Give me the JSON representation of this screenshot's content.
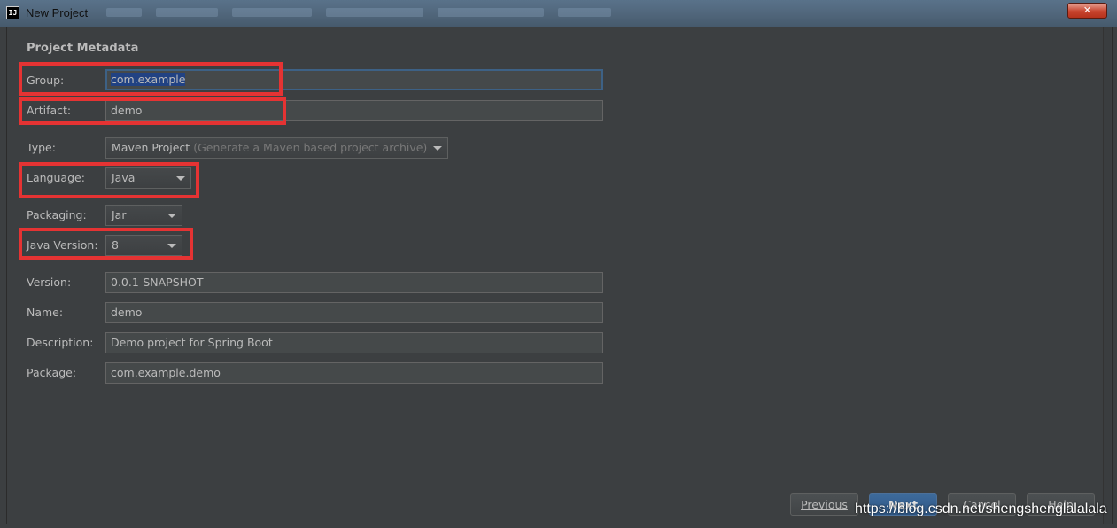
{
  "window": {
    "title": "New Project",
    "close_label": "✕"
  },
  "section_title": "Project Metadata",
  "form": {
    "group": {
      "label": "Group:",
      "value": "com.example"
    },
    "artifact": {
      "label": "Artifact:",
      "value": "demo"
    },
    "type": {
      "label": "Type:",
      "value": "Maven Project",
      "hint": "(Generate a Maven based project archive)"
    },
    "language": {
      "label": "Language:",
      "value": "Java"
    },
    "packaging": {
      "label": "Packaging:",
      "value": "Jar"
    },
    "java_version": {
      "label": "Java Version:",
      "value": "8"
    },
    "version": {
      "label": "Version:",
      "value": "0.0.1-SNAPSHOT"
    },
    "name": {
      "label": "Name:",
      "value": "demo"
    },
    "description": {
      "label": "Description:",
      "value": "Demo project for Spring Boot"
    },
    "package": {
      "label": "Package:",
      "value": "com.example.demo"
    }
  },
  "buttons": {
    "previous": "Previous",
    "next": "Next",
    "cancel": "Cancel",
    "help": "Help"
  },
  "watermark": "https://blog.csdn.net/shengshenglalalala",
  "colors": {
    "background": "#3c3f41",
    "field_bg": "#45494a",
    "highlight": "#e53333",
    "focus": "#3d6185",
    "primary_button": "#2f5785"
  }
}
